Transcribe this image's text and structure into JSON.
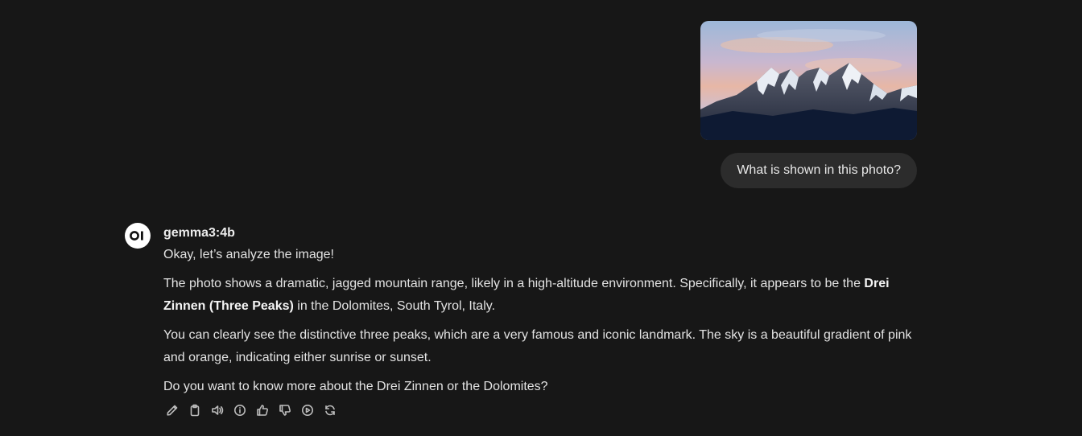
{
  "user_message": {
    "attachment_alt": "mountain photo",
    "text": "What is shown in this photo?"
  },
  "assistant": {
    "avatar_text": "OI",
    "model_name": "gemma3:4b",
    "intro": "Okay, let’s analyze the image!",
    "paragraph1_pre": "The photo shows a dramatic, jagged mountain range, likely in a high-altitude environment. Specifically, it appears to be the ",
    "paragraph1_bold": "Drei Zinnen (Three Peaks)",
    "paragraph1_post": " in the Dolomites, South Tyrol, Italy.",
    "paragraph2": "You can clearly see the distinctive three peaks, which are a very famous and iconic landmark. The sky is a beautiful gradient of pink and orange, indicating either sunrise or sunset.",
    "paragraph3": "Do you want to know more about the Drei Zinnen or the Dolomites?"
  },
  "actions": [
    {
      "name": "edit-icon"
    },
    {
      "name": "copy-icon"
    },
    {
      "name": "read-aloud-icon"
    },
    {
      "name": "info-icon"
    },
    {
      "name": "thumbs-up-icon"
    },
    {
      "name": "thumbs-down-icon"
    },
    {
      "name": "continue-icon"
    },
    {
      "name": "regenerate-icon"
    }
  ],
  "colors": {
    "background": "#171717",
    "bubble": "#2c2c2c",
    "text": "#e3e3e3",
    "icon": "#bdbdbd"
  }
}
